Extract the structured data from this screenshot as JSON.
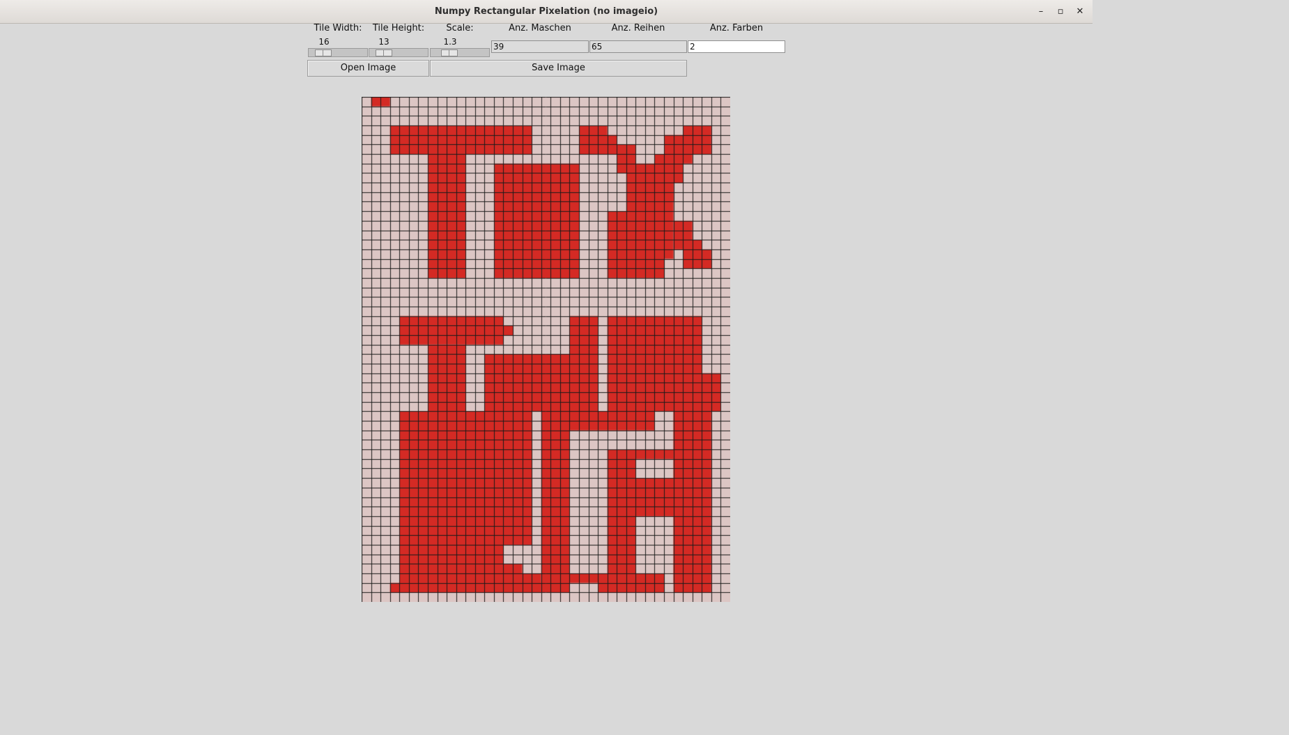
{
  "window": {
    "title": "Numpy Rectangular Pixelation (no imageio)",
    "minimize_glyph": "–",
    "maximize_glyph": "▫",
    "close_glyph": "✕"
  },
  "controls": {
    "tile_width": {
      "label": "Tile Width:",
      "value": "16"
    },
    "tile_height": {
      "label": "Tile Height:",
      "value": "13"
    },
    "scale": {
      "label": "Scale:",
      "value": "1.3"
    },
    "anz_maschen": {
      "label": "Anz. Maschen",
      "value": "39"
    },
    "anz_reihen": {
      "label": "Anz. Reihen",
      "value": "65"
    },
    "anz_farben": {
      "label": "Anz. Farben",
      "value": "2"
    }
  },
  "buttons": {
    "open": "Open Image",
    "save": "Save Image"
  },
  "pixel_image": {
    "columns": 39,
    "rows": 53,
    "colors": {
      "background": "#dcc6c4",
      "foreground": "#d42a24",
      "grid": "#1a1a1a"
    }
  }
}
